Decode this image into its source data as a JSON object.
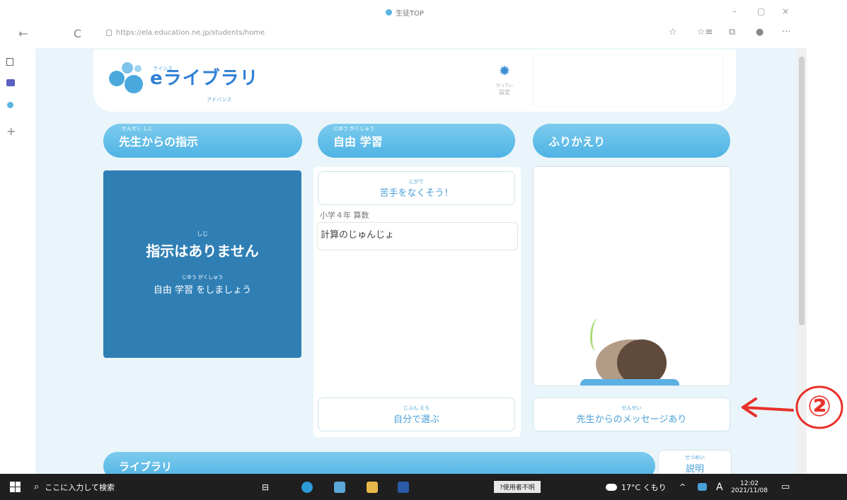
{
  "browser": {
    "tab_title": "生徒TOP",
    "url": "https://ela.education.ne.jp/students/home",
    "back_icon": "←",
    "refresh_icon": "C",
    "window_controls": [
      "–",
      "▢",
      "×"
    ],
    "toolbar_icons": [
      "☆",
      "☆≡",
      "⧉",
      "●",
      "···"
    ]
  },
  "sidebar": {
    "icons": [
      "tabs-icon",
      "teams-icon",
      "app-icon",
      "plus-icon"
    ]
  },
  "header": {
    "logo_text": "eライブラリ",
    "logo_small_top": "ライシス",
    "logo_small_bottom": "アドバンス",
    "settings_ruby": "せってい",
    "settings_label": "設定"
  },
  "columns": {
    "instruction": {
      "header_ruby": "せんせい                しじ",
      "header": "先生からの指示",
      "box_ruby_main": "しじ",
      "box_main": "指示はありません",
      "box_ruby_sub": "じゆう がくしゅう",
      "box_sub": "自由 学習 をしましょう"
    },
    "free_study": {
      "header_ruby": "じゆう がくしゅう",
      "header": "自由 学習",
      "weak_ruby": "にがて",
      "weak_button": "苦手をなくそう！",
      "grade": "小学４年 算数",
      "topic": "計算のじゅんじょ",
      "choose_ruby": "じぶん  えら",
      "choose_button": "自分で選ぶ"
    },
    "reflection": {
      "header": "ふりかえり",
      "message_ruby": "せんせい",
      "message_button": "先生からのメッセージあり"
    }
  },
  "library": {
    "label": "ライブラリ",
    "explain_ruby": "せつめい",
    "explain_button": "説明"
  },
  "annotation": {
    "label": "②"
  },
  "taskbar": {
    "search_placeholder": "ここに入力して検索",
    "badge": "?使用者不明",
    "weather": "17°C くもり",
    "ime": "A",
    "time": "12:02",
    "date": "2021/11/08"
  },
  "colors": {
    "accent": "#4fb3e4",
    "instruction_box": "#2f7fb5",
    "app_background": "#e9f5fa",
    "annotation": "#e8302a"
  }
}
